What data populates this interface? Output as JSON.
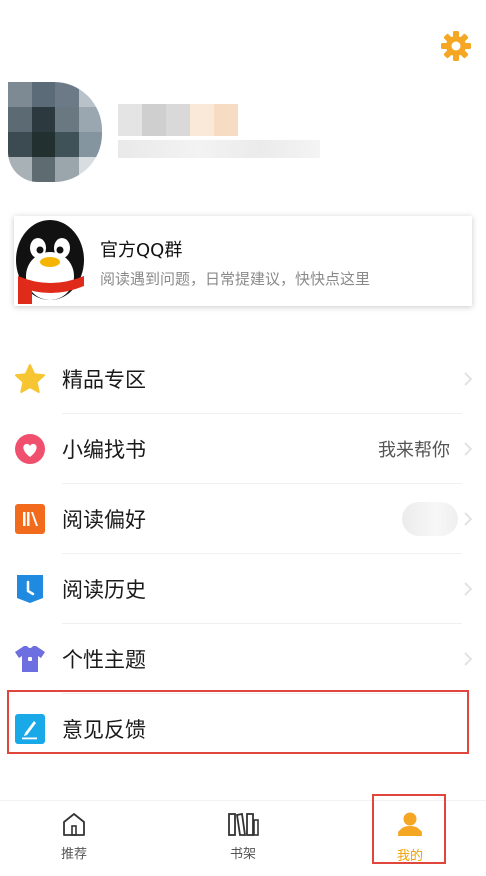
{
  "colors": {
    "accent": "#f5a623",
    "highlight_border": "#e0463c"
  },
  "header": {
    "settings_icon": "gear-icon"
  },
  "qq_card": {
    "title": "官方QQ群",
    "subtitle": "阅读遇到问题，日常提建议，快快点这里"
  },
  "menu": {
    "items": [
      {
        "label": "精品专区",
        "icon": "star-icon"
      },
      {
        "label": "小编找书",
        "icon": "heart-icon",
        "value": "我来帮你"
      },
      {
        "label": "阅读偏好",
        "icon": "books-icon"
      },
      {
        "label": "阅读历史",
        "icon": "bookmark-icon"
      },
      {
        "label": "个性主题",
        "icon": "tshirt-icon"
      },
      {
        "label": "意见反馈",
        "icon": "pencil-icon"
      }
    ]
  },
  "tabbar": {
    "tabs": [
      {
        "label": "推荐",
        "icon": "home-icon"
      },
      {
        "label": "书架",
        "icon": "bookshelf-icon"
      },
      {
        "label": "我的",
        "icon": "profile-icon",
        "active": true
      }
    ]
  }
}
